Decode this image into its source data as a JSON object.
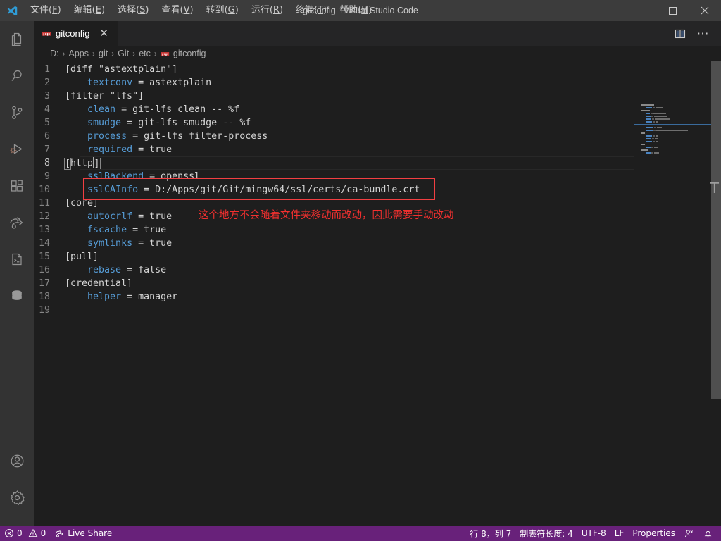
{
  "window": {
    "title": "gitconfig - Visual Studio Code",
    "minimize_label": "─",
    "maximize_label": "□",
    "close_label": "✕"
  },
  "menu": {
    "items": [
      {
        "label": "文件",
        "mnemonic": "F",
        "name": "menu-file"
      },
      {
        "label": "编辑",
        "mnemonic": "E",
        "name": "menu-edit"
      },
      {
        "label": "选择",
        "mnemonic": "S",
        "name": "menu-selection"
      },
      {
        "label": "查看",
        "mnemonic": "V",
        "name": "menu-view"
      },
      {
        "label": "转到",
        "mnemonic": "G",
        "name": "menu-go"
      },
      {
        "label": "运行",
        "mnemonic": "R",
        "name": "menu-run"
      },
      {
        "label": "终端",
        "mnemonic": "T",
        "name": "menu-terminal"
      },
      {
        "label": "帮助",
        "mnemonic": "H",
        "name": "menu-help"
      }
    ]
  },
  "activitybar": {
    "items": [
      {
        "icon": "explorer-icon",
        "name": "activity-explorer"
      },
      {
        "icon": "search-icon",
        "name": "activity-search"
      },
      {
        "icon": "source-control-icon",
        "name": "activity-source-control"
      },
      {
        "icon": "run-debug-icon",
        "name": "activity-run-debug"
      },
      {
        "icon": "extensions-icon",
        "name": "activity-extensions"
      },
      {
        "icon": "live-share-icon",
        "name": "activity-live-share"
      },
      {
        "icon": "terminal-script-icon",
        "name": "activity-terminal"
      },
      {
        "icon": "database-icon",
        "name": "activity-database"
      }
    ],
    "bottom": [
      {
        "icon": "account-icon",
        "name": "activity-account"
      },
      {
        "icon": "settings-gear-icon",
        "name": "activity-settings"
      }
    ]
  },
  "tab": {
    "label": "gitconfig",
    "icon": "properties-file-icon",
    "close_label": "✕"
  },
  "tabbar_actions": {
    "split_editor": "split-editor-icon",
    "more_actions": "⋯"
  },
  "breadcrumbs": {
    "separator": "›",
    "items": [
      "D:",
      "Apps",
      "git",
      "Git",
      "etc",
      "gitconfig"
    ]
  },
  "editor": {
    "current_line": 8,
    "total_lines": 19,
    "lines": [
      {
        "n": 1,
        "indent": 0,
        "tokens": [
          {
            "t": "section",
            "v": "[diff \"astextplain\"]"
          }
        ]
      },
      {
        "n": 2,
        "indent": 1,
        "tokens": [
          {
            "t": "key",
            "v": "textconv"
          },
          {
            "t": "eq",
            "v": " = "
          },
          {
            "t": "val",
            "v": "astextplain"
          }
        ]
      },
      {
        "n": 3,
        "indent": 0,
        "tokens": [
          {
            "t": "section",
            "v": "[filter \"lfs\"]"
          }
        ]
      },
      {
        "n": 4,
        "indent": 1,
        "tokens": [
          {
            "t": "key",
            "v": "clean"
          },
          {
            "t": "eq",
            "v": " = "
          },
          {
            "t": "val",
            "v": "git-lfs clean -- %f"
          }
        ]
      },
      {
        "n": 5,
        "indent": 1,
        "tokens": [
          {
            "t": "key",
            "v": "smudge"
          },
          {
            "t": "eq",
            "v": " = "
          },
          {
            "t": "val",
            "v": "git-lfs smudge -- %f"
          }
        ]
      },
      {
        "n": 6,
        "indent": 1,
        "tokens": [
          {
            "t": "key",
            "v": "process"
          },
          {
            "t": "eq",
            "v": " = "
          },
          {
            "t": "val",
            "v": "git-lfs filter-process"
          }
        ]
      },
      {
        "n": 7,
        "indent": 1,
        "tokens": [
          {
            "t": "key",
            "v": "required"
          },
          {
            "t": "eq",
            "v": " = "
          },
          {
            "t": "val",
            "v": "true"
          }
        ]
      },
      {
        "n": 8,
        "indent": 0,
        "current": true,
        "tokens": [
          {
            "t": "bracket",
            "v": "["
          },
          {
            "t": "section",
            "v": "http"
          },
          {
            "t": "cursor",
            "v": ""
          },
          {
            "t": "bracket",
            "v": "]"
          }
        ]
      },
      {
        "n": 9,
        "indent": 1,
        "tokens": [
          {
            "t": "key",
            "v": "sslBackend"
          },
          {
            "t": "eq",
            "v": " = "
          },
          {
            "t": "val",
            "v": "openssl"
          }
        ]
      },
      {
        "n": 10,
        "indent": 1,
        "tokens": [
          {
            "t": "key",
            "v": "sslCAInfo"
          },
          {
            "t": "eq",
            "v": " = "
          },
          {
            "t": "val",
            "v": "D:/Apps/git/Git/mingw64/ssl/certs/ca-bundle.crt"
          }
        ]
      },
      {
        "n": 11,
        "indent": 0,
        "tokens": [
          {
            "t": "section",
            "v": "[core]"
          }
        ]
      },
      {
        "n": 12,
        "indent": 1,
        "tokens": [
          {
            "t": "key",
            "v": "autocrlf"
          },
          {
            "t": "eq",
            "v": " = "
          },
          {
            "t": "val",
            "v": "true"
          }
        ]
      },
      {
        "n": 13,
        "indent": 1,
        "tokens": [
          {
            "t": "key",
            "v": "fscache"
          },
          {
            "t": "eq",
            "v": " = "
          },
          {
            "t": "val",
            "v": "true"
          }
        ]
      },
      {
        "n": 14,
        "indent": 1,
        "tokens": [
          {
            "t": "key",
            "v": "symlinks"
          },
          {
            "t": "eq",
            "v": " = "
          },
          {
            "t": "val",
            "v": "true"
          }
        ]
      },
      {
        "n": 15,
        "indent": 0,
        "tokens": [
          {
            "t": "section",
            "v": "[pull]"
          }
        ]
      },
      {
        "n": 16,
        "indent": 1,
        "tokens": [
          {
            "t": "key",
            "v": "rebase"
          },
          {
            "t": "eq",
            "v": " = "
          },
          {
            "t": "val",
            "v": "false"
          }
        ]
      },
      {
        "n": 17,
        "indent": 0,
        "tokens": [
          {
            "t": "section",
            "v": "[credential]"
          }
        ]
      },
      {
        "n": 18,
        "indent": 1,
        "tokens": [
          {
            "t": "key",
            "v": "helper"
          },
          {
            "t": "eq",
            "v": " = "
          },
          {
            "t": "val",
            "v": "manager"
          }
        ]
      },
      {
        "n": 19,
        "indent": 0,
        "tokens": []
      }
    ]
  },
  "annotations": {
    "highlight_box": {
      "target_line": 10,
      "color": "#f23f42"
    },
    "note": "这个地方不会随着文件夹移动而改动，因此需要手动改动",
    "note_color": "#f2302f"
  },
  "scrollbar": {
    "ghost_glyph": "T"
  },
  "statusbar": {
    "background": "#68217a",
    "errors": "0",
    "warnings": "0",
    "live_share": "Live Share",
    "cursor_position": "行 8，列 7",
    "tab_size": "制表符长度: 4",
    "encoding": "UTF-8",
    "eol": "LF",
    "language": "Properties",
    "feedback_icon": "feedback-icon",
    "bell_icon": "bell-icon"
  }
}
